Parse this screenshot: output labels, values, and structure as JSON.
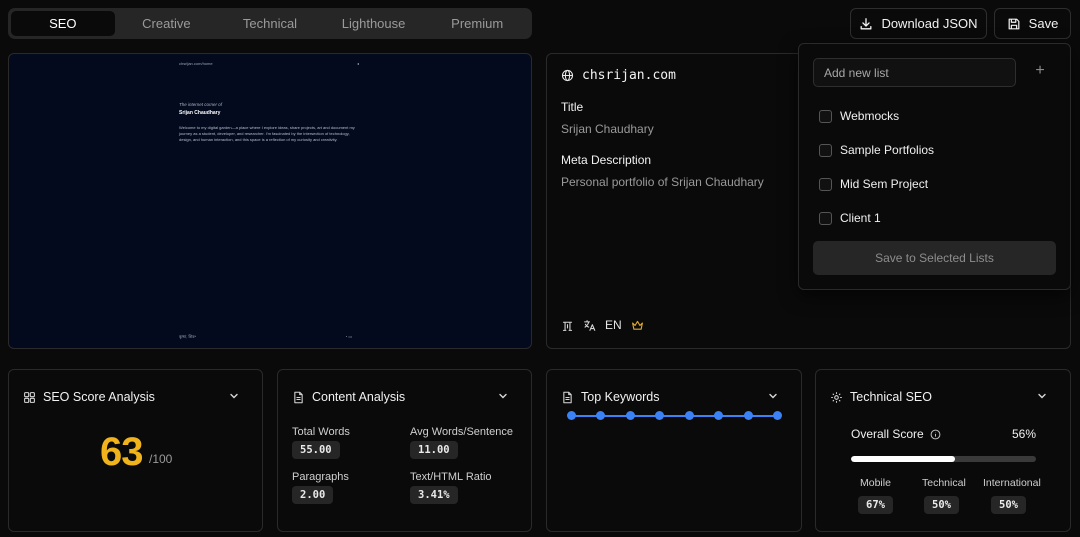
{
  "tabs": [
    {
      "label": "SEO",
      "active": true
    },
    {
      "label": "Creative",
      "active": false
    },
    {
      "label": "Technical",
      "active": false
    },
    {
      "label": "Lighthouse",
      "active": false
    },
    {
      "label": "Premium",
      "active": false
    }
  ],
  "toolbar": {
    "download_label": "Download JSON",
    "save_label": "Save"
  },
  "preview": {
    "url": "chsrijan.com/home",
    "corner": "◂",
    "tagline": "The internet corner of",
    "name": "Srijan Chaudhary",
    "body": "Welcome to my digital garden—a place where I explore ideas, share projects, art and document my journey as a student, developer, and researcher. I'm fascinated by the intersection of technology, design, and human interaction, and this space is a reflection of my curiosity and creativity.",
    "footer_left": "कृष्ण, शिव॰",
    "footer_right": "◔ ▭"
  },
  "info": {
    "site": "chsrijan.com",
    "title_label": "Title",
    "title_value": "Srijan Chaudhary",
    "meta_label": "Meta Description",
    "meta_value": "Personal portfolio of Srijan Chaudhary",
    "language": "EN"
  },
  "dropdown": {
    "input_placeholder": "Add new list",
    "plus": "+",
    "lists": [
      "Webmocks",
      "Sample Portfolios",
      "Mid Sem Project",
      "Client 1"
    ],
    "save_label": "Save to Selected Lists"
  },
  "seo_score": {
    "title": "SEO Score Analysis",
    "score": "63",
    "out_of": "/100",
    "score_color": "#f0b31c"
  },
  "content": {
    "title": "Content Analysis",
    "metrics": [
      {
        "label": "Total Words",
        "value": "55.00"
      },
      {
        "label": "Avg Words/Sentence",
        "value": "11.00"
      },
      {
        "label": "Paragraphs",
        "value": "2.00"
      },
      {
        "label": "Text/HTML Ratio",
        "value": "3.41%"
      }
    ]
  },
  "keywords": {
    "title": "Top Keywords",
    "dot_count": 8,
    "accent": "#3b82f6"
  },
  "technical": {
    "title": "Technical SEO",
    "overall_label": "Overall Score",
    "overall_value": "56%",
    "overall_fraction": 0.56,
    "subs": [
      {
        "label": "Mobile",
        "value": "67%"
      },
      {
        "label": "Technical",
        "value": "50%"
      },
      {
        "label": "International",
        "value": "50%"
      }
    ]
  }
}
